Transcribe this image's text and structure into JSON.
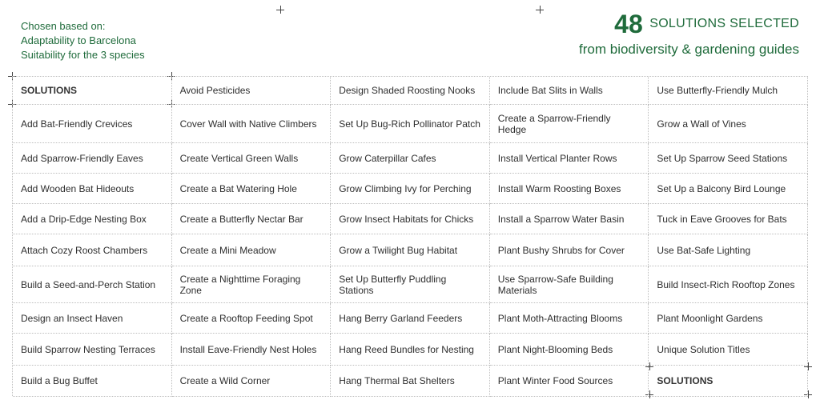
{
  "criteria": {
    "lines": [
      "Chosen based on:",
      "Adaptability to Barcelona",
      "Suitability for the 3 species"
    ]
  },
  "headline": {
    "count": "48",
    "label": "SOLUTIONS SELECTED",
    "source": "from biodiversity & gardening guides"
  },
  "table": {
    "columns": [
      [
        "SOLUTIONS",
        "Add Bat-Friendly Crevices",
        "Add Sparrow-Friendly Eaves",
        "Add Wooden Bat Hideouts",
        "Add a Drip-Edge Nesting Box",
        "Attach Cozy Roost Chambers",
        "Build a Seed-and-Perch Station",
        "Design an Insect Haven",
        "Build Sparrow Nesting Terraces",
        "Build a Bug Buffet"
      ],
      [
        "Avoid Pesticides",
        "Cover Wall with Native Climbers",
        "Create Vertical Green Walls",
        "Create a Bat Watering Hole",
        "Create a Butterfly Nectar Bar",
        "Create a Mini Meadow",
        "Create a Nighttime Foraging Zone",
        "Create a Rooftop Feeding Spot",
        "Install Eave-Friendly Nest Holes",
        "Create a Wild Corner"
      ],
      [
        "Design Shaded Roosting Nooks",
        "Set Up Bug-Rich Pollinator Patch",
        "Grow Caterpillar Cafes",
        "Grow Climbing Ivy for Perching",
        "Grow Insect Habitats for Chicks",
        "Grow a Twilight Bug Habitat",
        "Set Up Butterfly Puddling Stations",
        "Hang Berry Garland Feeders",
        "Hang Reed Bundles for Nesting",
        "Hang Thermal Bat Shelters"
      ],
      [
        "Include Bat Slits in Walls",
        "Create a Sparrow-Friendly Hedge",
        "Install Vertical Planter Rows",
        "Install Warm Roosting Boxes",
        "Install a Sparrow Water Basin",
        "Plant Bushy Shrubs for Cover",
        "Use Sparrow-Safe Building Materials",
        "Plant Moth-Attracting Blooms",
        "Plant Night-Blooming Beds",
        "Plant Winter Food Sources"
      ],
      [
        "Use Butterfly-Friendly Mulch",
        "Grow a Wall of Vines",
        "Set Up Sparrow Seed Stations",
        "Set Up a Balcony Bird Lounge",
        "Tuck in Eave Grooves for Bats",
        "Use Bat-Safe Lighting",
        "Build Insect-Rich Rooftop Zones",
        "Plant Moonlight Gardens",
        "Unique Solution Titles",
        "SOLUTIONS"
      ]
    ]
  }
}
